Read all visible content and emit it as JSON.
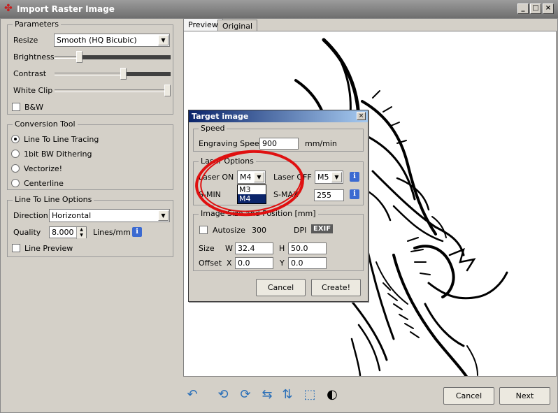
{
  "window": {
    "title": "Import Raster Image",
    "icon": "app-logo-icon",
    "controls": [
      "minimize-icon",
      "maximize-icon",
      "close-icon"
    ]
  },
  "parameters": {
    "legend": "Parameters",
    "resize_label": "Resize",
    "resize_value": "Smooth (HQ Bicubic)",
    "brightness_label": "Brightness",
    "brightness_level": 0.2,
    "contrast_label": "Contrast",
    "contrast_level": 0.6,
    "whiteclip_label": "White Clip",
    "whiteclip_level": 1.0,
    "bw_label": "B&W",
    "bw_checked": false
  },
  "conversion": {
    "legend": "Conversion Tool",
    "options": [
      "Line To Line Tracing",
      "1bit BW Dithering",
      "Vectorize!",
      "Centerline"
    ],
    "selected_index": 0
  },
  "line_options": {
    "legend": "Line To Line Options",
    "direction_label": "Direction",
    "direction_value": "Horizontal",
    "quality_label": "Quality",
    "quality_value": "8.000",
    "quality_unit": "Lines/mm",
    "line_preview_label": "Line Preview",
    "line_preview_checked": false
  },
  "tabs": [
    {
      "label": "Preview",
      "active": true
    },
    {
      "label": "Original",
      "active": false
    }
  ],
  "footer": {
    "cancel_label": "Cancel",
    "next_label": "Next",
    "tools": [
      "reset-icon",
      "rotate-ccw-icon",
      "rotate-cw-icon",
      "flip-horizontal-icon",
      "flip-vertical-icon",
      "crop-icon",
      "invert-icon"
    ]
  },
  "dialog": {
    "title": "Target image",
    "speed_legend": "Speed",
    "engraving_speed_label": "Engraving Speed",
    "engraving_speed_value": "900",
    "engraving_speed_unit": "mm/min",
    "laser_legend": "Laser Options",
    "laser_on_label": "Laser ON",
    "laser_on_value": "M4",
    "laser_on_options": [
      "M3",
      "M4"
    ],
    "laser_on_selected": "M4",
    "laser_off_label": "Laser OFF",
    "laser_off_value": "M5",
    "smin_label": "S-MIN",
    "smax_label": "S-MAX",
    "smax_value": "255",
    "size_legend": "Image Size and Position [mm]",
    "autosize_label": "Autosize",
    "autosize_checked": false,
    "dpi_value": "300",
    "dpi_label": "DPI",
    "exif_label": "EXIF",
    "size_label": "Size",
    "w_label": "W",
    "w_value": "32.4",
    "h_label": "H",
    "h_value": "50.0",
    "offset_label": "Offset",
    "x_label": "X",
    "x_value": "0.0",
    "y_label": "Y",
    "y_value": "0.0",
    "cancel_label": "Cancel",
    "create_label": "Create!"
  },
  "annotation": {
    "color": "#e01010"
  }
}
